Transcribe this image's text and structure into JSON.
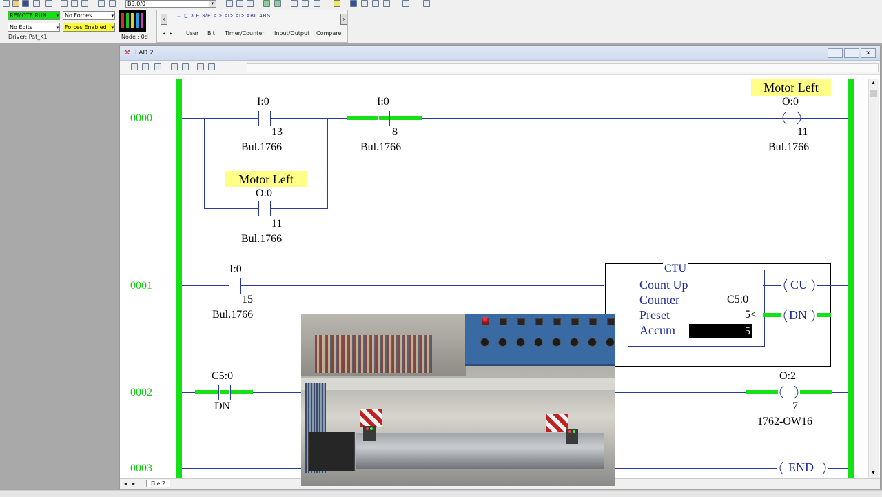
{
  "toolbar": {
    "address_value": "B3:0/0",
    "mode": "REMOTE RUN",
    "edits": "No Edits",
    "forces": "No Forces",
    "forces_enabled": "Forces Enabled",
    "driver": "Driver: Pat_K1",
    "node": "Node : 0d",
    "instruction_tabs": [
      "User",
      "Bit",
      "Timer/Counter",
      "Input/Output",
      "Compare"
    ],
    "instruction_glyphs": [
      "←",
      "⊑",
      "3 E",
      "3/E",
      "< >",
      "<I>",
      "<I>",
      "ABL",
      "ABS"
    ]
  },
  "window": {
    "title": "LAD 2",
    "file_tab": "File 2"
  },
  "rungs": [
    {
      "number": "0000",
      "elements": {
        "c1": {
          "address": "I:0",
          "bit": "13",
          "module": "Bul.1766"
        },
        "c2": {
          "address": "I:0",
          "bit": "8",
          "module": "Bul.1766"
        },
        "coil": {
          "label": "Motor Left",
          "address": "O:0",
          "bit": "11",
          "module": "Bul.1766"
        },
        "branch": {
          "label": "Motor Left",
          "address": "O:0",
          "bit": "11",
          "module": "Bul.1766"
        }
      }
    },
    {
      "number": "0001",
      "contact": {
        "address": "I:0",
        "bit": "15",
        "module": "Bul.1766"
      },
      "ctu": {
        "title": "CTU",
        "name": "Count Up",
        "counter_label": "Counter",
        "counter_value": "C5:0",
        "preset_label": "Preset",
        "preset_value": "5<",
        "accum_label": "Accum",
        "accum_value": "5",
        "cu": "CU",
        "dn": "DN"
      }
    },
    {
      "number": "0002",
      "contact": {
        "address": "C5:0",
        "bit": "DN"
      },
      "coil": {
        "address": "O:2",
        "bit": "7",
        "module": "1762-OW16"
      }
    },
    {
      "number": "0003",
      "end": "END"
    }
  ],
  "colors": {
    "energized": "#16e016",
    "rung_number": "#10c810",
    "wire": "#2a3a9a",
    "symbol_highlight": "#ffff88"
  }
}
